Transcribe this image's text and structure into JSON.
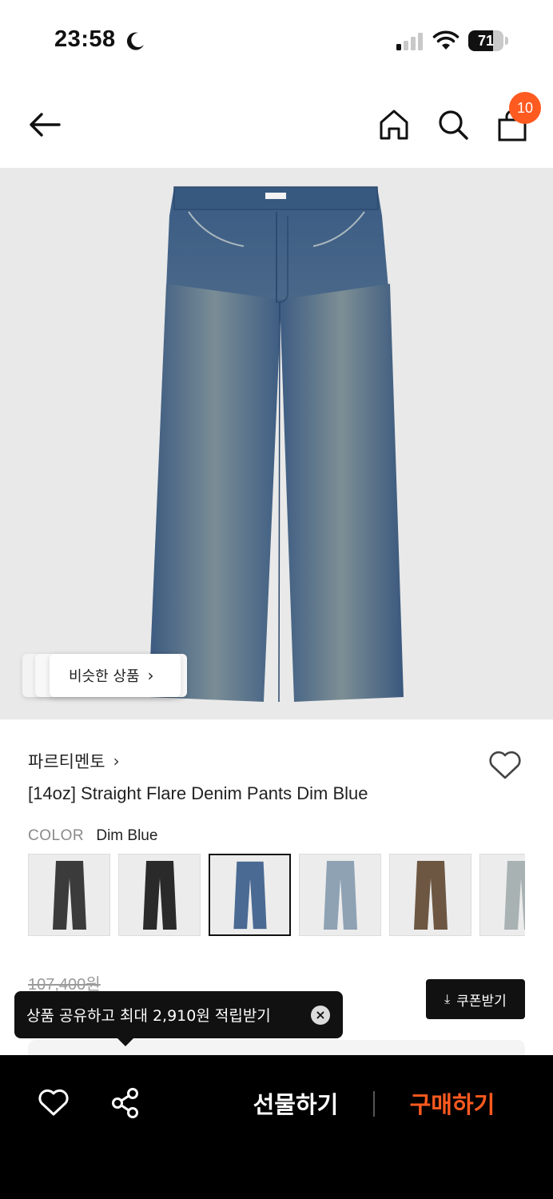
{
  "status_bar": {
    "time": "23:58",
    "battery_level": "71",
    "battery_fraction": 0.71
  },
  "top_nav": {
    "cart_badge": "10",
    "icons": [
      "back-arrow-icon",
      "home-icon",
      "search-icon",
      "shopping-bag-icon"
    ]
  },
  "product_image": {
    "similar_products_label": "비슷한 상품",
    "chevron": "›"
  },
  "product": {
    "brand": "파르티멘토",
    "brand_chevron": "›",
    "name": "[14oz] Straight Flare Denim Pants Dim Blue",
    "color_label": "COLOR",
    "color_value": "Dim Blue",
    "swatches": [
      {
        "name": "black-washed",
        "color": "#3b3b3b"
      },
      {
        "name": "black",
        "color": "#2a2a2a"
      },
      {
        "name": "dim-blue",
        "color": "#4a6a93",
        "selected": true
      },
      {
        "name": "light-washed-blue",
        "color": "#8ea2b4"
      },
      {
        "name": "brown",
        "color": "#6d5742"
      },
      {
        "name": "light-grey-blue",
        "color": "#a9b2b3"
      }
    ],
    "original_price": "107,400원"
  },
  "coupon": {
    "label": "쿠폰받기",
    "icon": "download-icon"
  },
  "tooltip": {
    "text": "상품 공유하고 최대 2,910원 적립받기",
    "close": "×"
  },
  "bottom_bar": {
    "gift_label": "선물하기",
    "buy_label": "구매하기",
    "buy_color": "#ff5a1f"
  }
}
